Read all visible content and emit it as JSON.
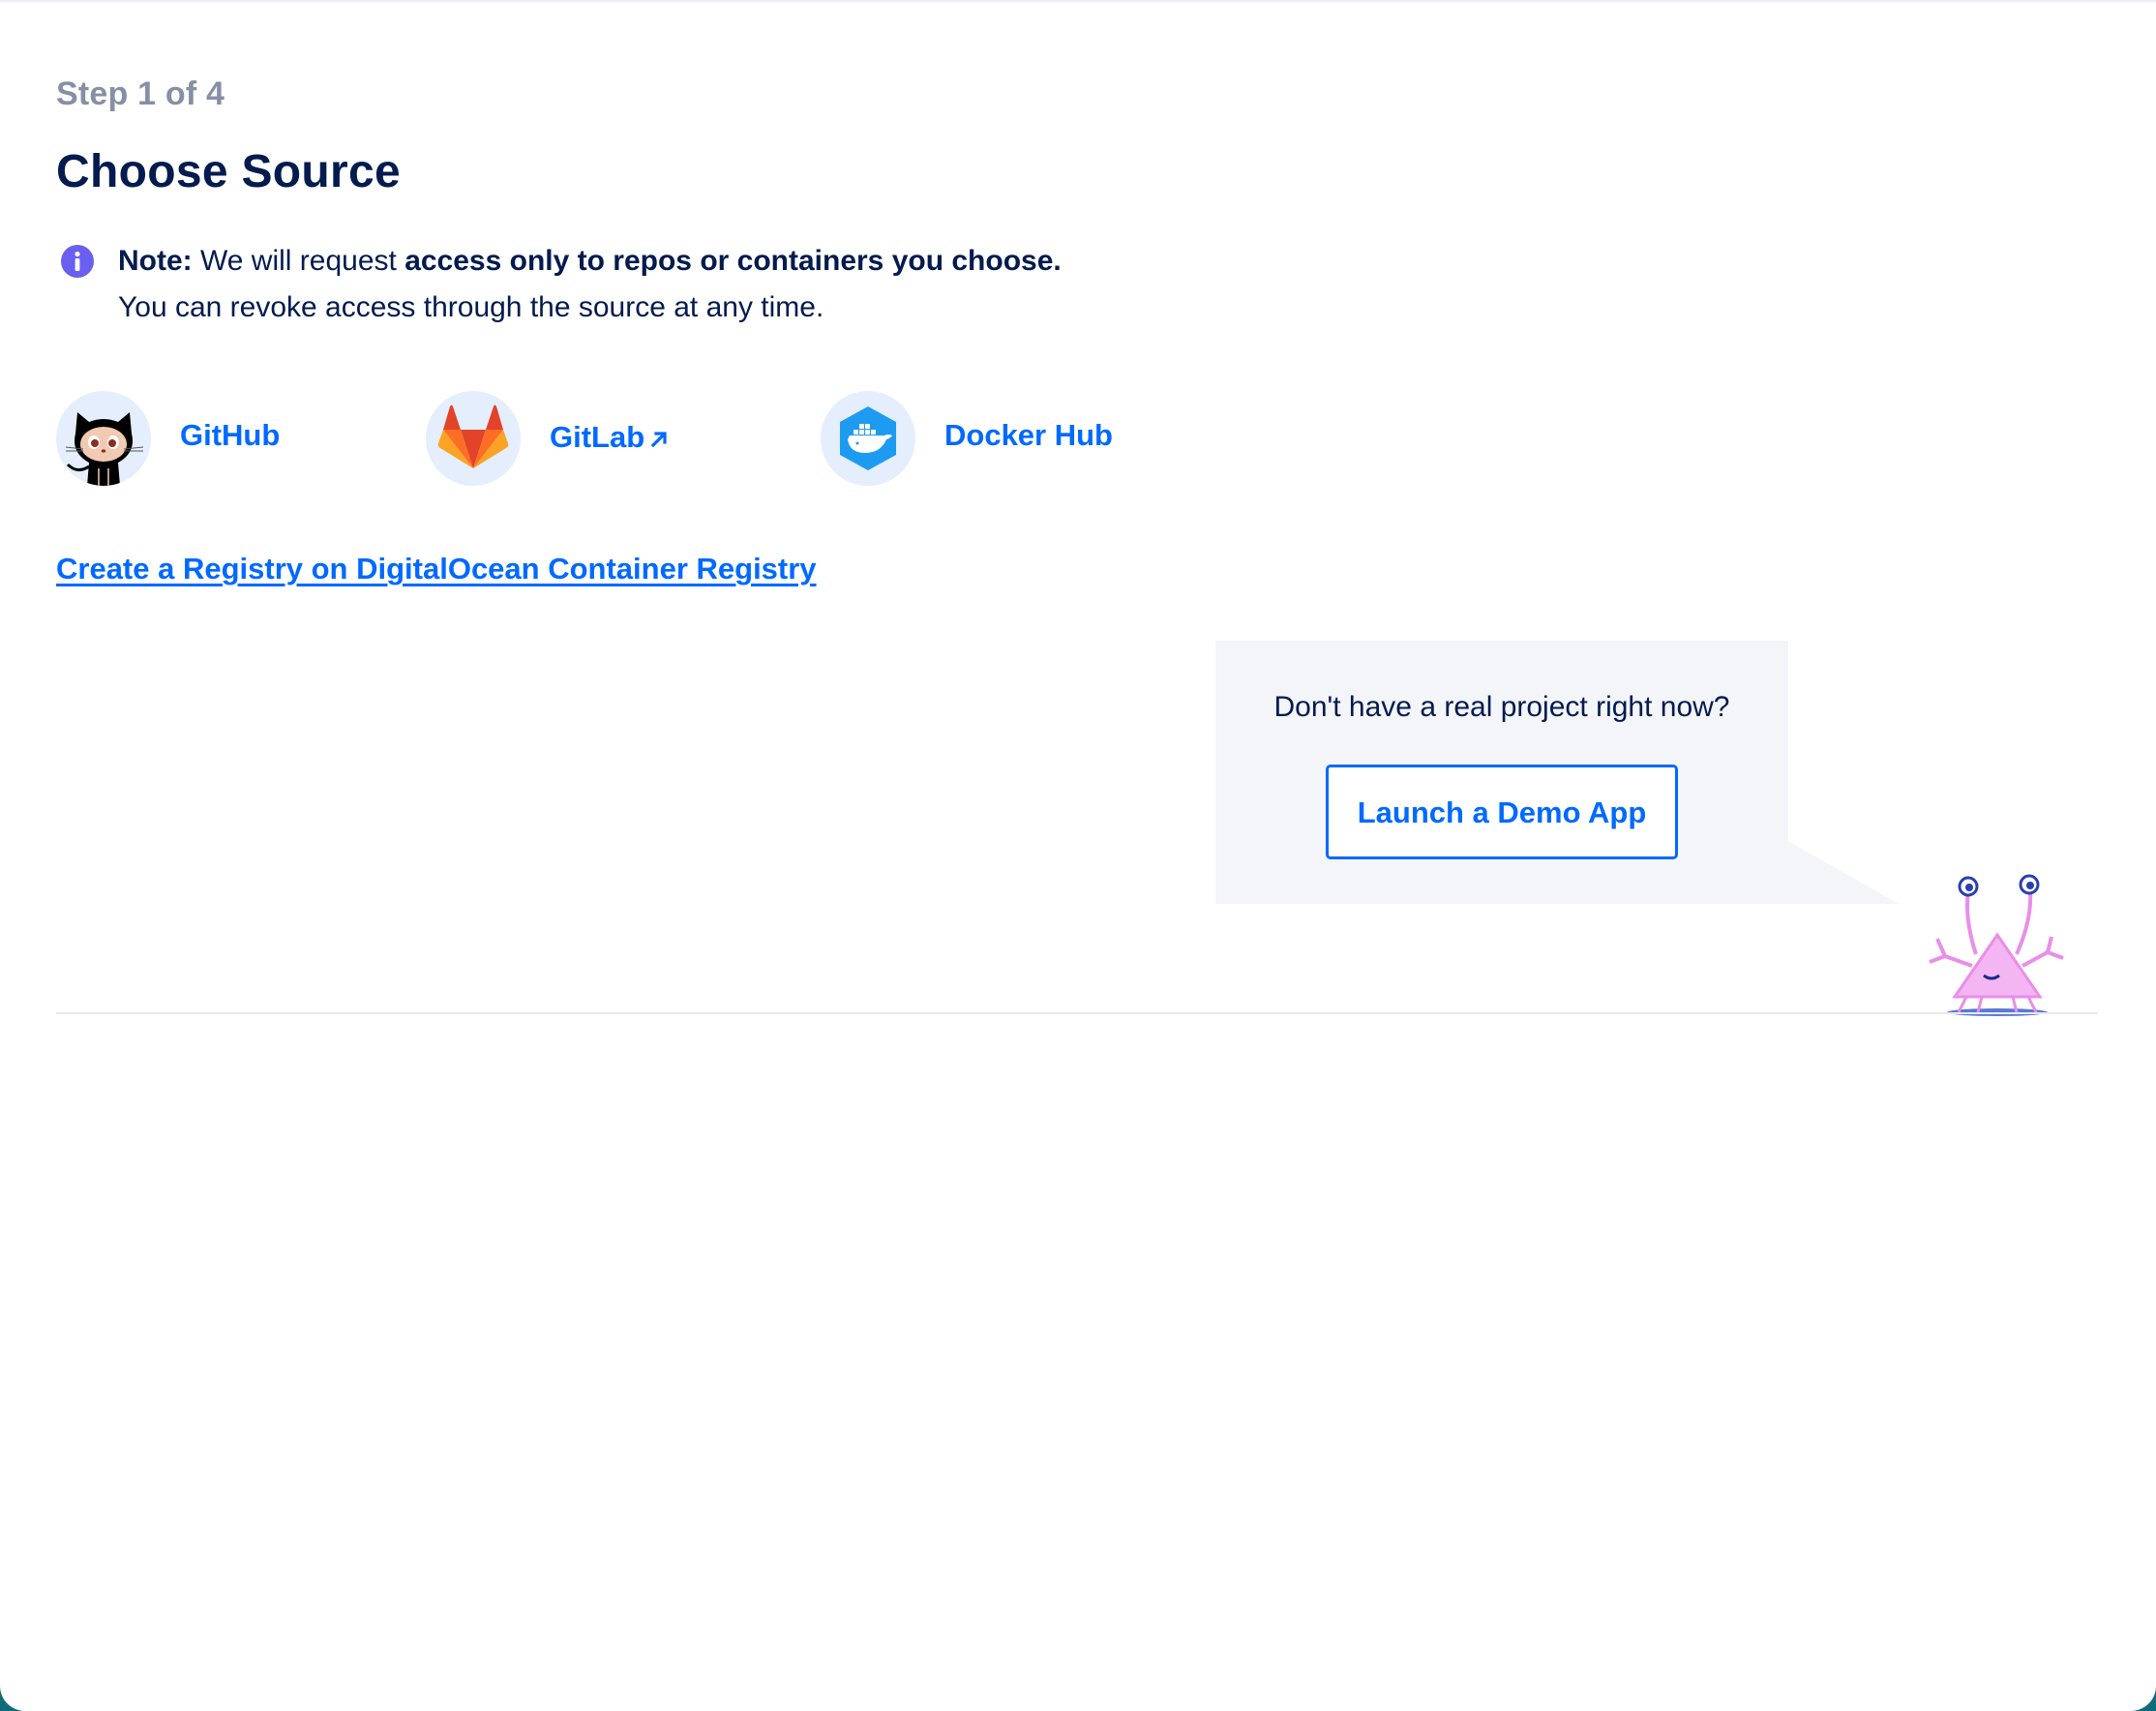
{
  "step": {
    "label": "Step 1 of 4"
  },
  "title": "Choose Source",
  "note": {
    "icon": "info-icon",
    "prefix_bold": "Note:",
    "prefix_text": " We will request ",
    "emphasis": "access only to repos or containers you choose.",
    "line2": "You can revoke access through the source at any time."
  },
  "sources": [
    {
      "label": "GitHub",
      "icon": "github-octocat-icon"
    },
    {
      "label": "GitLab",
      "icon": "gitlab-fox-icon",
      "external_icon": "external-link-icon"
    },
    {
      "label": "Docker Hub",
      "icon": "docker-whale-icon"
    }
  ],
  "registry_link": "Create a Registry on DigitalOcean Container Registry",
  "demo": {
    "prompt": "Don't have a real project right now?",
    "button_label": "Launch a Demo App",
    "mascot": "sammy-crab-mascot"
  },
  "colors": {
    "primary": "#0069ff",
    "heading": "#031b4e",
    "muted": "#8590a6",
    "info": "#6a5ff0",
    "panel": "#f3f5f9",
    "icon_bg": "#e4eefc"
  }
}
